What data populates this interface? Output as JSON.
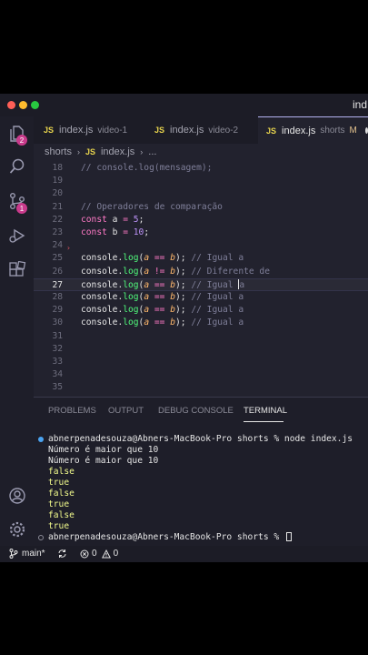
{
  "window": {
    "title": "ind",
    "dots": [
      "#ff5f57",
      "#febc2e",
      "#28c840"
    ]
  },
  "activity": {
    "explorer_badge": "2",
    "scm_badge": "1"
  },
  "tabs": [
    {
      "label": "index.js",
      "desc": "video-1"
    },
    {
      "label": "index.js",
      "desc": "video-2"
    },
    {
      "label": "index.js",
      "desc": "shorts",
      "modified": "M"
    }
  ],
  "breadcrumb": {
    "folder": "shorts",
    "file": "index.js",
    "more": "..."
  },
  "editor": {
    "lines": [
      {
        "n": "18",
        "comment": "// console.log(mensagem);"
      },
      {
        "n": "19"
      },
      {
        "n": "20"
      },
      {
        "n": "21",
        "comment": "// Operadores de comparação"
      },
      {
        "n": "22",
        "kw": "const",
        "name": "a",
        "eq": "=",
        "val": "5",
        "end": ";"
      },
      {
        "n": "23",
        "kw": "const",
        "name": "b",
        "eq": "=",
        "val": "10",
        "end": ";"
      },
      {
        "n": "24"
      },
      {
        "n": "25",
        "op": "==",
        "comment": "// Igual a"
      },
      {
        "n": "26",
        "op": "!=",
        "comment": "// Diferente de"
      },
      {
        "n": "27",
        "op": "==",
        "comment": "// Igual a"
      },
      {
        "n": "28",
        "op": "==",
        "comment": "// Igual a"
      },
      {
        "n": "29",
        "op": "==",
        "comment": "// Igual a"
      },
      {
        "n": "30",
        "op": "==",
        "comment": "// Igual a"
      },
      {
        "n": "31"
      },
      {
        "n": "32"
      },
      {
        "n": "33"
      },
      {
        "n": "34"
      },
      {
        "n": "35"
      }
    ],
    "console_obj": "console",
    "console_fn": "log",
    "param_a": "a",
    "param_b": "b"
  },
  "panel": {
    "tabs": [
      "PROBLEMS",
      "OUTPUT",
      "DEBUG CONSOLE",
      "TERMINAL"
    ],
    "active_tab": "TERMINAL",
    "terminal": [
      {
        "text": "abnerpenadesouza@Abners-MacBook-Pro shorts % node index.js",
        "prompt": true
      },
      {
        "text": "Número é maior que 10"
      },
      {
        "text": "Número é maior que 10"
      },
      {
        "text": "false",
        "val": true
      },
      {
        "text": "true",
        "val": true
      },
      {
        "text": "false",
        "val": true
      },
      {
        "text": "true",
        "val": true
      },
      {
        "text": "false",
        "val": true
      },
      {
        "text": "true",
        "val": true
      },
      {
        "text": "abnerpenadesouza@Abners-MacBook-Pro shorts % ",
        "prompt": true,
        "hollow": true
      }
    ]
  },
  "statusbar": {
    "branch": "main*",
    "errors": "0",
    "warnings": "0"
  }
}
